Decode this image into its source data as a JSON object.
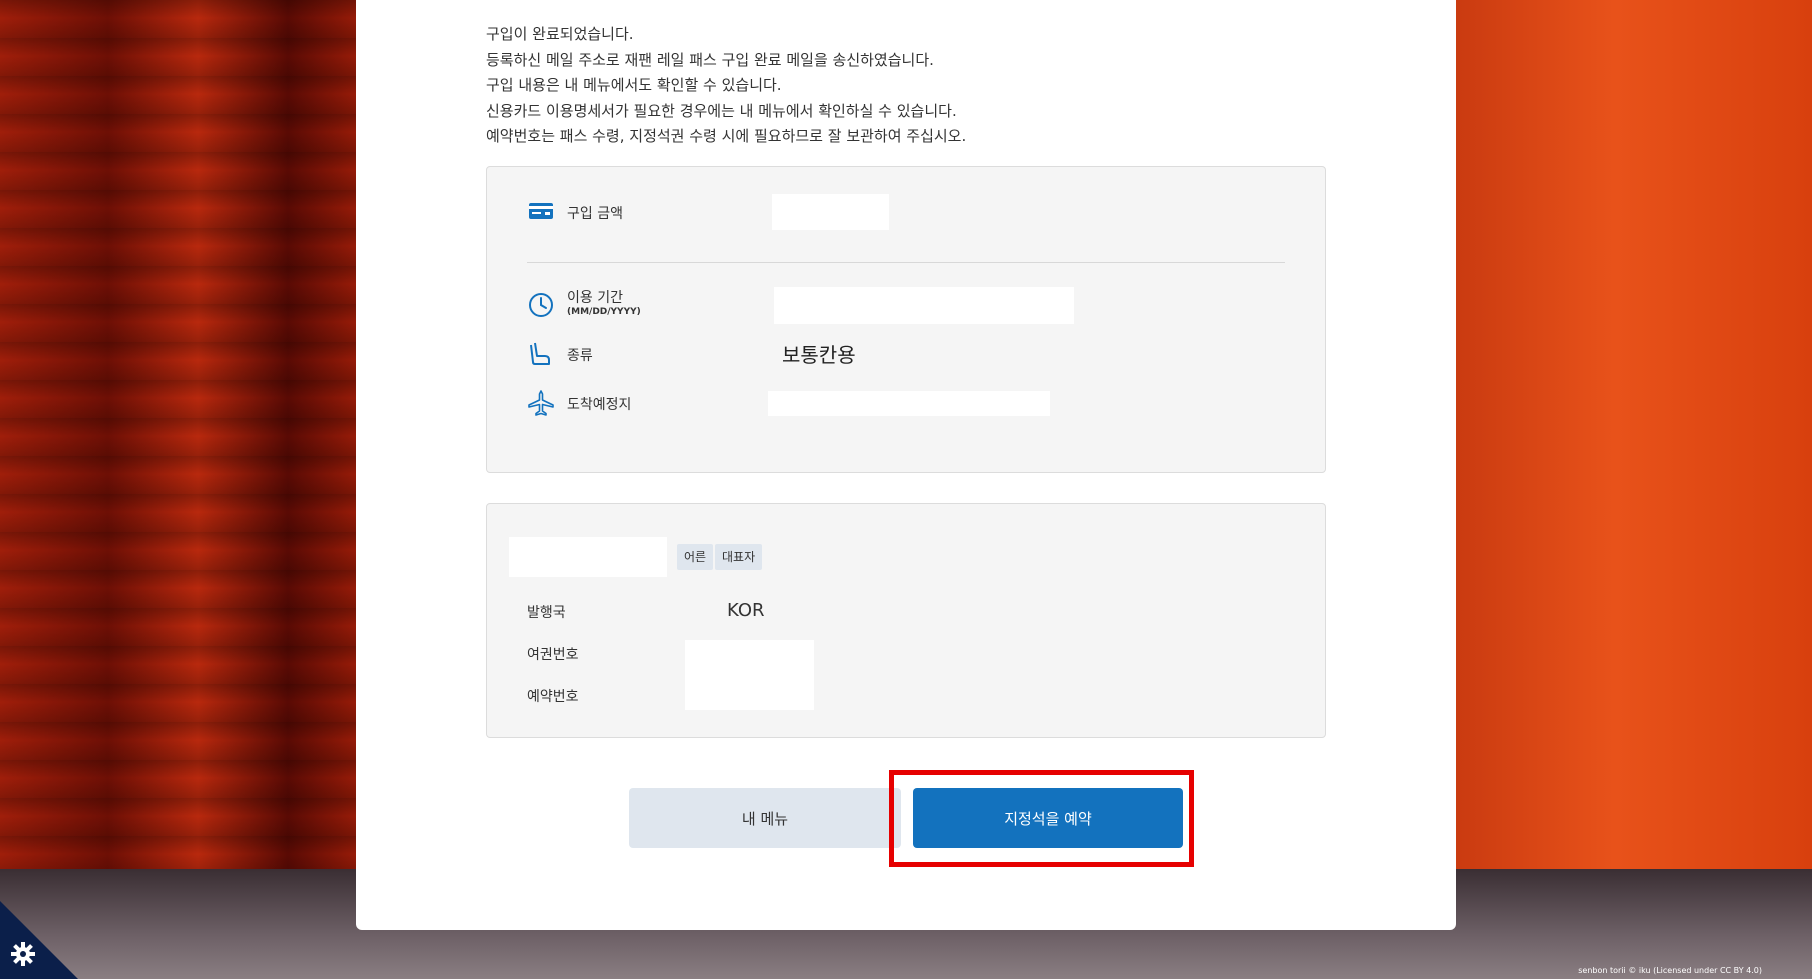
{
  "notice": {
    "lines": [
      "구입이 완료되었습니다.",
      "등록하신 메일 주소로 재팬 레일 패스 구입 완료 메일을 송신하였습니다.",
      "구입 내용은 내 메뉴에서도 확인할 수 있습니다.",
      "신용카드 이용명세서가 필요한 경우에는 내 메뉴에서 확인하실 수 있습니다.",
      "예약번호는 패스 수령, 지정석권 수령 시에 필요하므로 잘 보관하여 주십시오."
    ]
  },
  "purchase": {
    "amount_label": "구입 금액",
    "period_label": "이용 기간",
    "period_format": "(MM/DD/YYYY)",
    "type_label": "종류",
    "type_value": "보통칸용",
    "destination_label": "도착예정지"
  },
  "passenger": {
    "tag_adult": "어른",
    "tag_representative": "대표자",
    "country_label": "발행국",
    "country_value": "KOR",
    "passport_label": "여권번호",
    "reservation_label": "예약번호"
  },
  "buttons": {
    "my_menu": "내 메뉴",
    "reserve_seat": "지정석을 예약"
  },
  "footer": {
    "credit": "senbon torii © iku (Licensed under CC BY 4.0)"
  },
  "colors": {
    "primary": "#1372be",
    "secondary": "#dfe6ee",
    "highlight": "#e60000"
  }
}
